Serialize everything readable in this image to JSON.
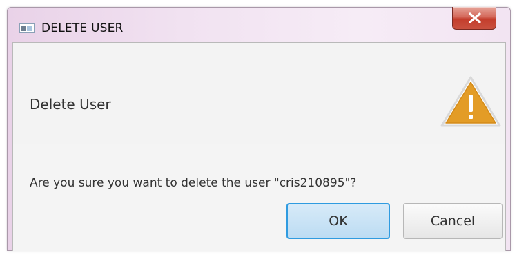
{
  "window": {
    "title": "DELETE USER",
    "close_icon": "close-icon"
  },
  "dialog": {
    "header_text": "Delete User",
    "icon": "warning-icon",
    "content_text": "Are you sure you want to delete the user \"cris210895\"?",
    "buttons": {
      "ok_label": "OK",
      "cancel_label": "Cancel"
    }
  },
  "colors": {
    "accent_focus_border": "#2f9be0",
    "warning_fill": "#e39c26",
    "close_button": "#c33d2c"
  }
}
